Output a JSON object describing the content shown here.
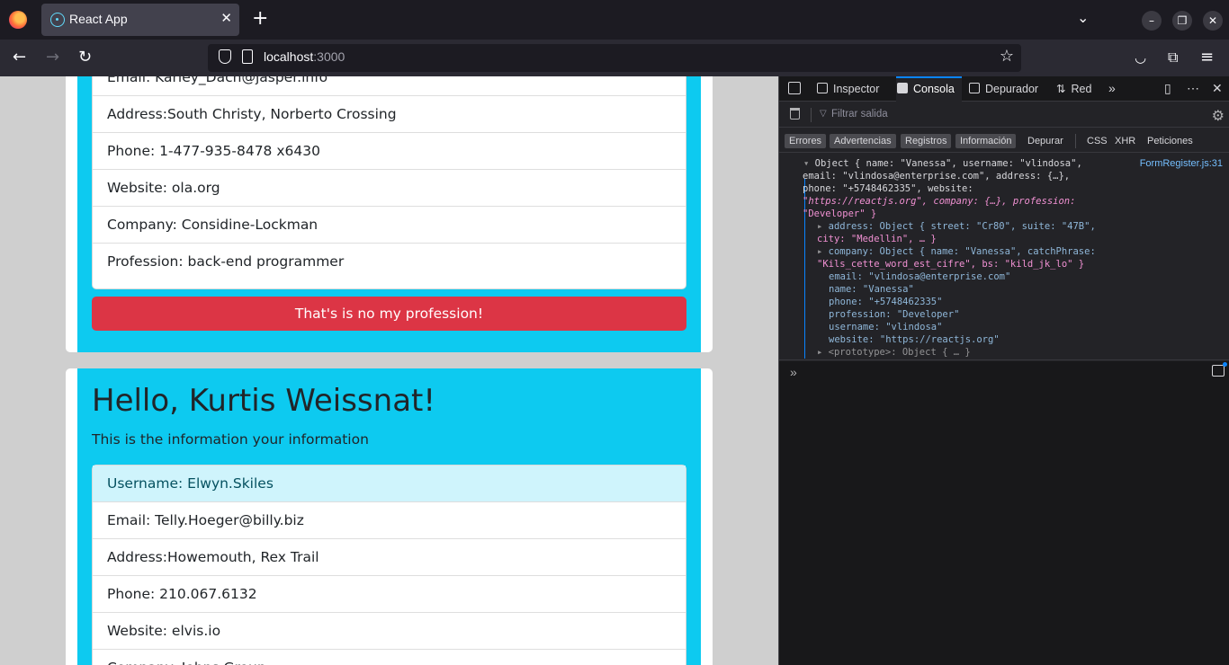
{
  "browser": {
    "tab_title": "React App",
    "tab_close": "✕",
    "new_tab": "+",
    "url_host": "localhost",
    "url_port": ":3000"
  },
  "card_prev": {
    "items": [
      "Email: Karley_Dach@jasper.info",
      "Address:South Christy, Norberto Crossing",
      "Phone: 1-477-935-8478 x6430",
      "Website: ola.org",
      "Company: Considine-Lockman",
      "Profession: back-end programmer"
    ],
    "button": "That's is no my profession!"
  },
  "card_next": {
    "greeting": "Hello, Kurtis Weissnat!",
    "subtitle": "This is the information your information",
    "items": [
      "Username: Elwyn.Skiles",
      "Email: Telly.Hoeger@billy.biz",
      "Address:Howemouth, Rex Trail",
      "Phone: 210.067.6132",
      "Website: elvis.io",
      "Company: Johns Group"
    ]
  },
  "devtools": {
    "tabs": [
      "Inspector",
      "Consola",
      "Depurador",
      "Red"
    ],
    "filter_placeholder": "Filtrar salida",
    "levels": [
      "Errores",
      "Advertencias",
      "Registros",
      "Información",
      "Depurar",
      "CSS",
      "XHR",
      "Peticiones"
    ],
    "log_source": "FormRegister.js:31",
    "log": {
      "l1": "Object { name: \"Vanessa\", username: \"vlindosa\",",
      "l2": "email: \"vlindosa@enterprise.com\", address: {…},",
      "l3": "phone: \"+5748462335\", website:",
      "l4": "\"https://reactjs.org\", company: {…}, profession:",
      "l5": "\"Developer\" }",
      "l6": "address: Object { street: \"Cr80\", suite: \"47B\",",
      "l7": "city: \"Medellin\", … }",
      "l8": "company: Object { name: \"Vanessa\", catchPhrase:",
      "l9": "\"Kils_cette_word_est_cifre\", bs: \"kild_jk_lo\" }",
      "l10": "email: \"vlindosa@enterprise.com\"",
      "l11": "name: \"Vanessa\"",
      "l12": "phone: \"+5748462335\"",
      "l13": "profession: \"Developer\"",
      "l14": "username: \"vlindosa\"",
      "l15": "website: \"https://reactjs.org\"",
      "l16": "<prototype>: Object { … }"
    }
  }
}
